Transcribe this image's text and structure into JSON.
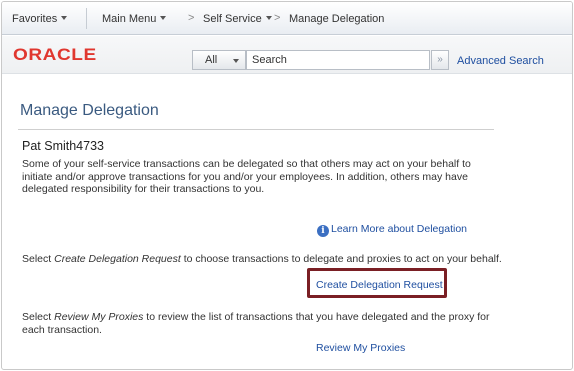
{
  "nav": {
    "favorites": "Favorites",
    "main_menu": "Main Menu",
    "separator": ">",
    "self_service": "Self Service",
    "current_page": "Manage Delegation"
  },
  "header": {
    "logo": "ORACLE",
    "search_scope": "All",
    "search_placeholder": "Search",
    "search_button": "»",
    "advanced_search": "Advanced Search"
  },
  "page": {
    "title": "Manage Delegation",
    "user_name": "Pat Smith4733",
    "intro": "Some of your self-service transactions can be delegated so that others may act on your behalf to initiate and/or approve transactions for you and/or your employees. In addition, others may have delegated responsibility for their transactions to you.",
    "learn_more_icon": "i",
    "learn_more": "Learn More about Delegation",
    "create_prefix": "Select ",
    "create_emph": "Create Delegation Request",
    "create_suffix": " to choose transactions to delegate and proxies to act on your behalf.",
    "create_link": "Create Delegation Request",
    "review_prefix": "Select ",
    "review_emph": "Review My Proxies",
    "review_suffix": " to review the list of transactions that you have delegated and the proxy for each transaction.",
    "review_link": "Review My Proxies"
  },
  "icons": {
    "info": "info-circle-icon",
    "dropdown": "chevron-down-icon",
    "search_go": "double-chevron-right-icon"
  },
  "colors": {
    "logo": "#e0372f",
    "link": "#1f4fa0",
    "title": "#3a5a80",
    "highlight_border": "#7a1f24"
  }
}
